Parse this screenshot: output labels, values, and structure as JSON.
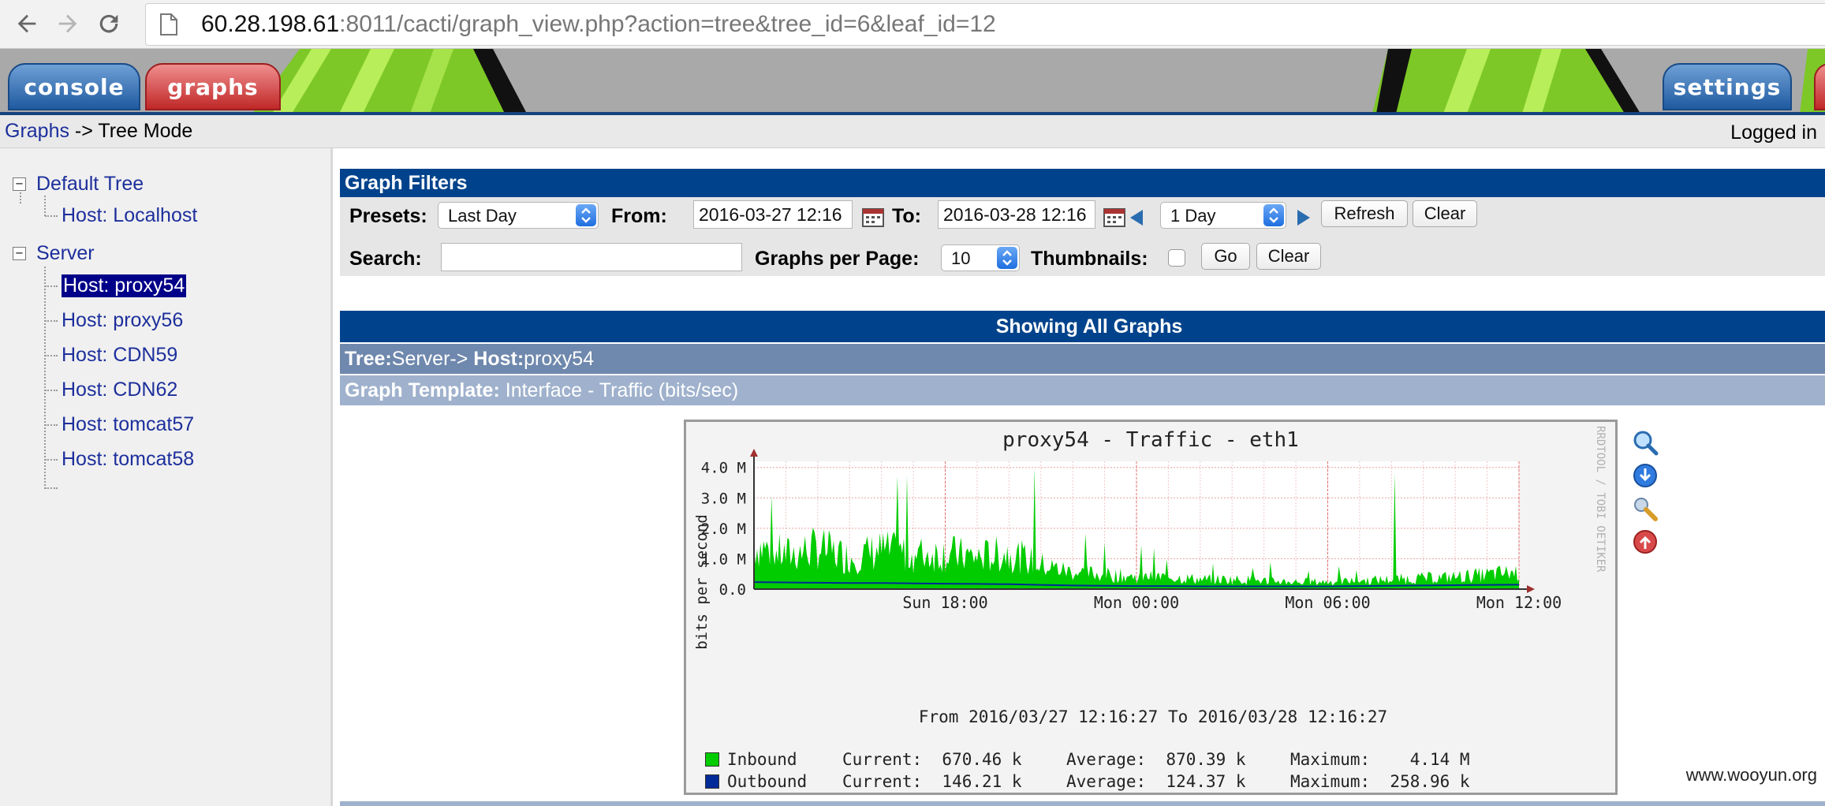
{
  "browser": {
    "url_host": "60.28.198.61",
    "url_path": ":8011/cacti/graph_view.php?action=tree&tree_id=6&leaf_id=12",
    "icons": [
      "back-icon",
      "forward-icon",
      "reload-icon",
      "page-icon"
    ]
  },
  "header": {
    "tabs": {
      "console": "console",
      "graphs": "graphs",
      "settings": "settings"
    }
  },
  "breadcrumb": {
    "link": "Graphs",
    "rest": " -> Tree Mode",
    "logged": "Logged in"
  },
  "tree": {
    "items": [
      {
        "label": "Default Tree",
        "level": 0,
        "expander": "⊟"
      },
      {
        "label": "Host: Localhost",
        "level": 1
      },
      {
        "label": "Server",
        "level": 0,
        "expander": "⊟"
      },
      {
        "label": "Host: proxy54",
        "level": 1,
        "selected": true
      },
      {
        "label": "Host: proxy56",
        "level": 1
      },
      {
        "label": "Host: CDN59",
        "level": 1
      },
      {
        "label": "Host: CDN62",
        "level": 1
      },
      {
        "label": "Host: tomcat57",
        "level": 1
      },
      {
        "label": "Host: tomcat58",
        "level": 1
      }
    ]
  },
  "filters": {
    "title": "Graph Filters",
    "presets_label": "Presets:",
    "presets_value": "Last Day",
    "from_label": "From:",
    "from_value": "2016-03-27 12:16",
    "to_label": "To:",
    "to_value": "2016-03-28 12:16",
    "span_value": "1 Day",
    "refresh": "Refresh",
    "clear": "Clear",
    "search_label": "Search:",
    "search_value": "",
    "gpp_label": "Graphs per Page:",
    "gpp_value": "10",
    "thumbs_label": "Thumbnails:",
    "go": "Go",
    "clear2": "Clear"
  },
  "listing": {
    "showing": "Showing All Graphs",
    "tree_label": "Tree:",
    "tree_value": "Server->",
    "host_label": " Host:",
    "host_value": "proxy54",
    "template_label": "Graph Template:",
    "template_value": " Interface - Traffic (bits/sec)"
  },
  "graph": {
    "title": "proxy54 - Traffic - eth1",
    "ylabel": "bits per second",
    "side_text": "RRDTOOL / TOBI OETIKER",
    "from_to": "From 2016/03/27 12:16:27 To 2016/03/28 12:16:27",
    "colors": {
      "inbound": "#00cc00",
      "outbound": "#002a97",
      "grid": "#e8a0a0"
    },
    "legend": [
      {
        "name": "Inbound",
        "current": "Current:  670.46 k",
        "average": "Average:  870.39 k",
        "maximum": "Maximum:    4.14 M"
      },
      {
        "name": "Outbound",
        "current": "Current:  146.21 k",
        "average": "Average:  124.37 k",
        "maximum": "Maximum:  258.96 k"
      }
    ],
    "icons": [
      "zoom-icon",
      "export-icon",
      "properties-icon",
      "top-icon"
    ]
  },
  "chart_data": {
    "type": "area",
    "title": "proxy54 - Traffic - eth1",
    "ylabel": "bits per second",
    "y_ticks": [
      "0.0",
      "1.0 M",
      "2.0 M",
      "3.0 M",
      "4.0 M"
    ],
    "x_ticks": [
      "Sun 18:00",
      "Mon 00:00",
      "Mon 06:00",
      "Mon 12:00"
    ],
    "ylim": [
      0,
      4200000
    ],
    "x_hours_from_start": [
      0,
      1,
      2,
      3,
      4,
      5,
      6,
      7,
      8,
      9,
      10,
      11,
      12,
      13,
      14,
      15,
      16,
      17,
      18,
      19,
      20,
      21,
      22,
      23,
      24
    ],
    "series": [
      {
        "name": "Inbound",
        "values": [
          1800000,
          1400000,
          1700000,
          1300000,
          1600000,
          1400000,
          1500000,
          1300000,
          1500000,
          1000000,
          700000,
          600000,
          500000,
          500000,
          400000,
          400000,
          350000,
          300000,
          300000,
          350000,
          400000,
          450000,
          500000,
          600000,
          700000
        ]
      },
      {
        "name": "Outbound",
        "values": [
          230000,
          220000,
          210000,
          200000,
          200000,
          190000,
          180000,
          170000,
          160000,
          140000,
          120000,
          110000,
          100000,
          100000,
          90000,
          90000,
          90000,
          90000,
          90000,
          100000,
          110000,
          120000,
          130000,
          140000,
          146000
        ]
      }
    ]
  },
  "watermark": "www.wooyun.org"
}
